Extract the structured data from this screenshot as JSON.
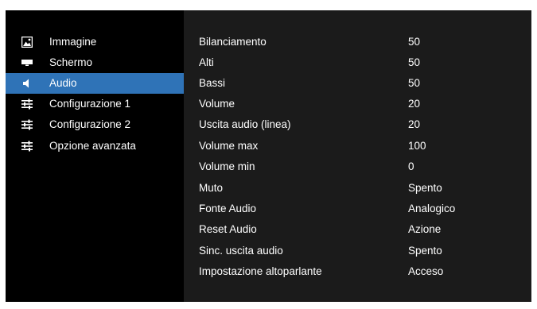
{
  "sidebar": {
    "items": [
      {
        "label": "Immagine",
        "icon": "image-icon",
        "selected": false
      },
      {
        "label": "Schermo",
        "icon": "screen-icon",
        "selected": false
      },
      {
        "label": "Audio",
        "icon": "speaker-icon",
        "selected": true
      },
      {
        "label": "Configurazione 1",
        "icon": "sliders-icon",
        "selected": false
      },
      {
        "label": "Configurazione 2",
        "icon": "sliders-icon",
        "selected": false
      },
      {
        "label": "Opzione avanzata",
        "icon": "sliders-icon",
        "selected": false
      }
    ]
  },
  "settings": {
    "rows": [
      {
        "label": "Bilanciamento",
        "value": "50"
      },
      {
        "label": "Alti",
        "value": "50"
      },
      {
        "label": "Bassi",
        "value": "50"
      },
      {
        "label": "Volume",
        "value": "20"
      },
      {
        "label": "Uscita audio (linea)",
        "value": "20"
      },
      {
        "label": "Volume max",
        "value": "100"
      },
      {
        "label": "Volume min",
        "value": "0"
      },
      {
        "label": "Muto",
        "value": "Spento"
      },
      {
        "label": "Fonte Audio",
        "value": "Analogico"
      },
      {
        "label": "Reset Audio",
        "value": "Azione"
      },
      {
        "label": "Sinc. uscita audio",
        "value": "Spento"
      },
      {
        "label": "Impostazione altoparlante",
        "value": "Acceso"
      }
    ]
  },
  "colors": {
    "background": "#000000",
    "panel": "#1b1b1b",
    "selected": "#2f73b7",
    "text": "#ffffff"
  }
}
